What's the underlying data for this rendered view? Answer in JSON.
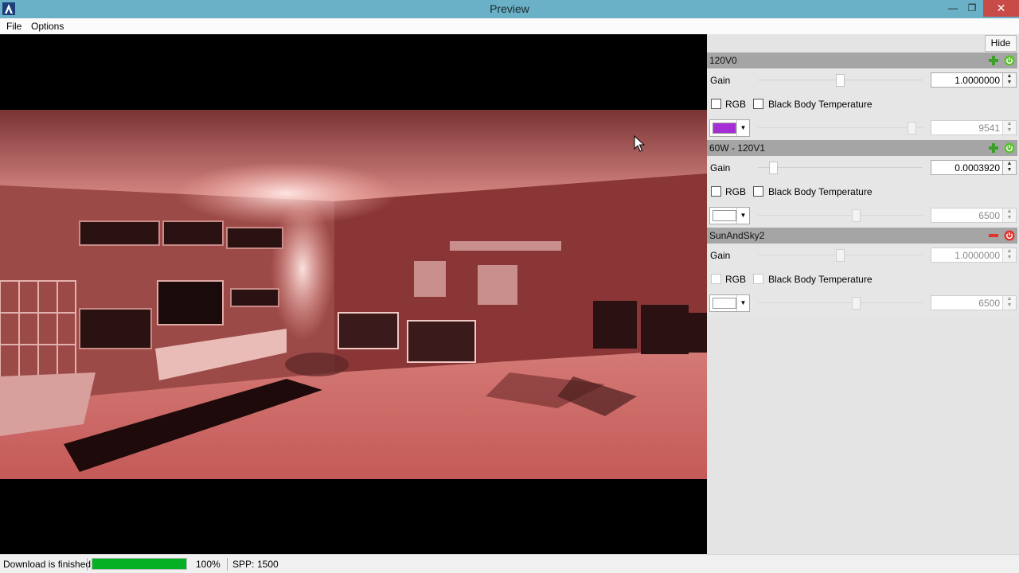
{
  "window": {
    "title": "Preview",
    "minimize": "—",
    "maximize": "❐",
    "close": "✕"
  },
  "menu": {
    "items": [
      "File",
      "Options"
    ]
  },
  "panel": {
    "hide_label": "Hide",
    "groups": [
      {
        "title": "120V0",
        "gain_label": "Gain",
        "gain_value": "1.0000000",
        "gain_level": 0.5,
        "rgb_label": "RGB",
        "bbt_label": "Black Body Temperature",
        "color": "#a52fd4",
        "temp_value": "9541",
        "temp_level": 0.96,
        "enabled": true,
        "head_icons": [
          "add-icon",
          "power-on-icon"
        ]
      },
      {
        "title": "60W - 120V1",
        "gain_label": "Gain",
        "gain_value": "0.0003920",
        "gain_level": 0.07,
        "rgb_label": "RGB",
        "bbt_label": "Black Body Temperature",
        "color": "#ffffff",
        "temp_value": "6500",
        "temp_level": 0.6,
        "enabled": true,
        "head_icons": [
          "add-icon",
          "power-on-icon"
        ]
      },
      {
        "title": "SunAndSky2",
        "gain_label": "Gain",
        "gain_value": "1.0000000",
        "gain_level": 0.5,
        "rgb_label": "RGB",
        "bbt_label": "Black Body Temperature",
        "color": "#ffffff",
        "temp_value": "6500",
        "temp_level": 0.6,
        "enabled": false,
        "head_icons": [
          "minus-icon",
          "power-off-icon"
        ]
      }
    ]
  },
  "status": {
    "message": "Download is finished",
    "progress": 1.0,
    "percent_text": "100%",
    "spp_label": "SPP:",
    "spp_value": "1500"
  },
  "colors": {
    "titlebar": "#6ab0c6",
    "progress_fill": "#06b025",
    "close_button": "#c84b47"
  }
}
